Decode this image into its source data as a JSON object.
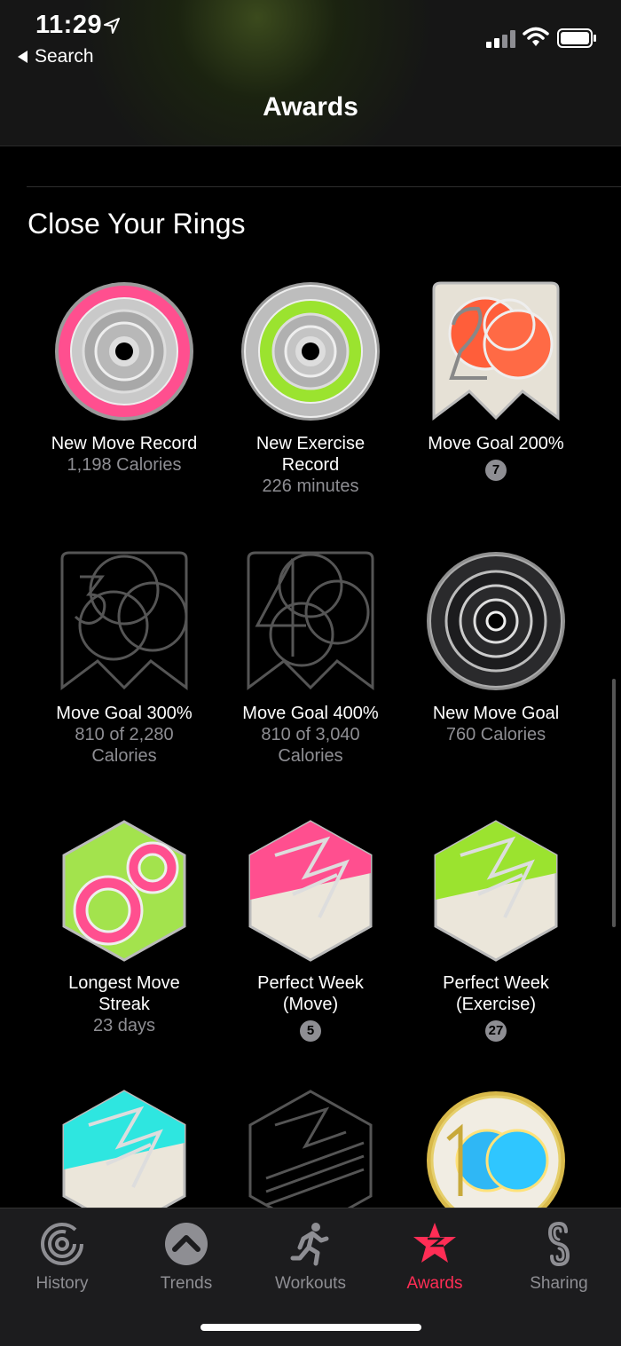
{
  "status_bar": {
    "time": "11:29"
  },
  "nav": {
    "back_label": "Search",
    "title": "Awards"
  },
  "section": {
    "title": "Close Your Rings"
  },
  "badges": [
    {
      "name": "New Move Record",
      "sub": "1,198 Calories",
      "icon": "move-record-medal",
      "color": "#ff4f8f"
    },
    {
      "name": "New Exercise Record",
      "sub": "226 minutes",
      "icon": "exercise-record-medal",
      "color": "#9be32f"
    },
    {
      "name": "Move Goal 200%",
      "count": "7",
      "icon": "move-goal-200-badge",
      "color": "#ff5e3a"
    },
    {
      "name": "Move Goal 300%",
      "sub": "810 of 2,280 Calories",
      "icon": "move-goal-300-outline-badge"
    },
    {
      "name": "Move Goal 400%",
      "sub": "810 of 3,040 Calories",
      "icon": "move-goal-400-outline-badge"
    },
    {
      "name": "New Move Goal",
      "sub": "760 Calories",
      "icon": "new-move-goal-medal"
    },
    {
      "name": "Longest Move Streak",
      "sub": "23 days",
      "icon": "longest-move-streak-badge",
      "color": "#a3e34d"
    },
    {
      "name": "Perfect Week (Move)",
      "count": "5",
      "icon": "perfect-week-move-badge",
      "color": "#ff4f8f"
    },
    {
      "name": "Perfect Week (Exercise)",
      "count": "27",
      "icon": "perfect-week-exercise-badge",
      "color": "#9be32f"
    },
    {
      "icon": "perfect-week-stand-badge",
      "color": "#2ee6e0"
    },
    {
      "icon": "perfect-week-all-outline-badge"
    },
    {
      "icon": "move-goal-100-days-badge",
      "color": "#2fb7f5"
    }
  ],
  "tabs": [
    {
      "label": "History",
      "icon": "history-rings-icon"
    },
    {
      "label": "Trends",
      "icon": "trends-chevron-icon"
    },
    {
      "label": "Workouts",
      "icon": "running-figure-icon"
    },
    {
      "label": "Awards",
      "icon": "award-star-icon",
      "active": true
    },
    {
      "label": "Sharing",
      "icon": "sharing-icon"
    }
  ],
  "colors": {
    "accent": "#ff2d55",
    "secondary_text": "#8e8e93"
  }
}
